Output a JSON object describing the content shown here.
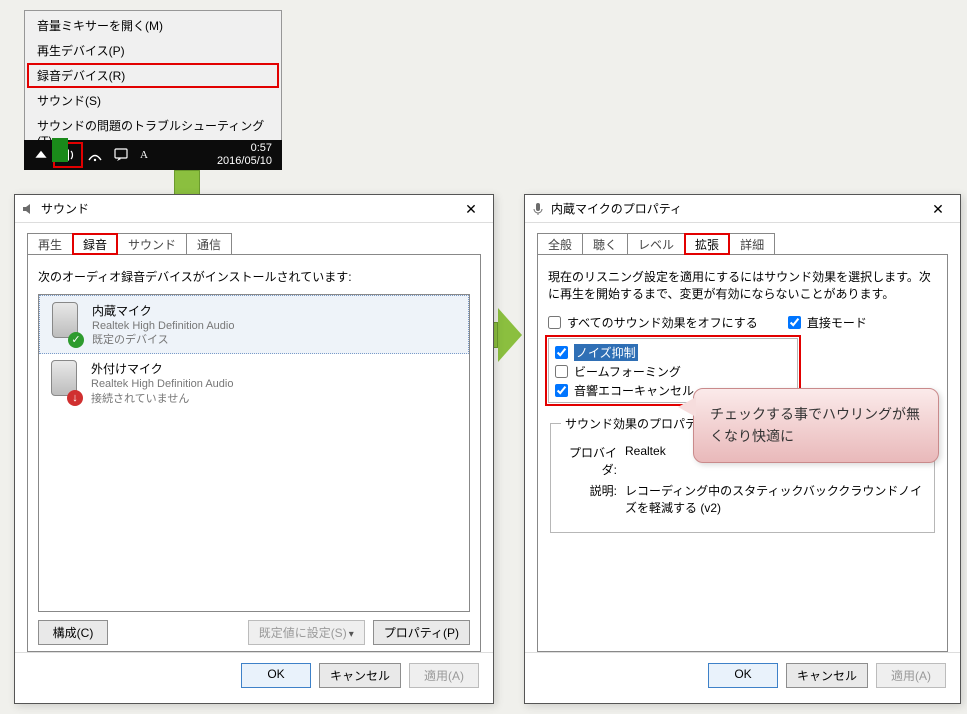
{
  "context_menu": {
    "items": [
      "音量ミキサーを開く(M)",
      "再生デバイス(P)",
      "録音デバイス(R)",
      "サウンド(S)",
      "サウンドの問題のトラブルシューティング(T)"
    ],
    "highlight_index": 2
  },
  "taskbar": {
    "clock_time": "0:57",
    "clock_date": "2016/05/10"
  },
  "sound_dialog": {
    "title": "サウンド",
    "tabs": [
      "再生",
      "録音",
      "サウンド",
      "通信"
    ],
    "active_tab_index": 1,
    "instruction": "次のオーディオ録音デバイスがインストールされています:",
    "devices": [
      {
        "name": "内蔵マイク",
        "driver": "Realtek High Definition Audio",
        "status": "既定のデバイス",
        "ok": true,
        "selected": true
      },
      {
        "name": "外付けマイク",
        "driver": "Realtek High Definition Audio",
        "status": "接続されていません",
        "ok": false,
        "selected": false
      }
    ],
    "btn_configure": "構成(C)",
    "btn_set_default": "既定値に設定(S)",
    "btn_properties": "プロパティ(P)",
    "btn_ok": "OK",
    "btn_cancel": "キャンセル",
    "btn_apply": "適用(A)"
  },
  "prop_dialog": {
    "title": "内蔵マイクのプロパティ",
    "tabs": [
      "全般",
      "聴く",
      "レベル",
      "拡張",
      "詳細"
    ],
    "active_tab_index": 3,
    "instruction": "現在のリスニング設定を適用にするにはサウンド効果を選択します。次に再生を開始するまで、変更が有効にならないことがあります。",
    "disable_all_label": "すべてのサウンド効果をオフにする",
    "direct_mode_label": "直接モード",
    "direct_mode_checked": true,
    "effects": [
      {
        "label": "ノイズ抑制",
        "checked": true,
        "selected": true
      },
      {
        "label": "ビームフォーミング",
        "checked": false,
        "selected": false
      },
      {
        "label": "音響エコーキャンセル",
        "checked": true,
        "selected": false
      }
    ],
    "props_legend": "サウンド効果のプロパティ",
    "provider_label": "プロバイダ:",
    "provider_value": "Realtek",
    "desc_label": "説明:",
    "desc_value": "レコーディング中のスタティックバッククラウンドノイズを軽減する (v2)",
    "btn_ok": "OK",
    "btn_cancel": "キャンセル",
    "btn_apply": "適用(A)"
  },
  "callout_text": "チェックする事でハウリングが無くなり快適に"
}
